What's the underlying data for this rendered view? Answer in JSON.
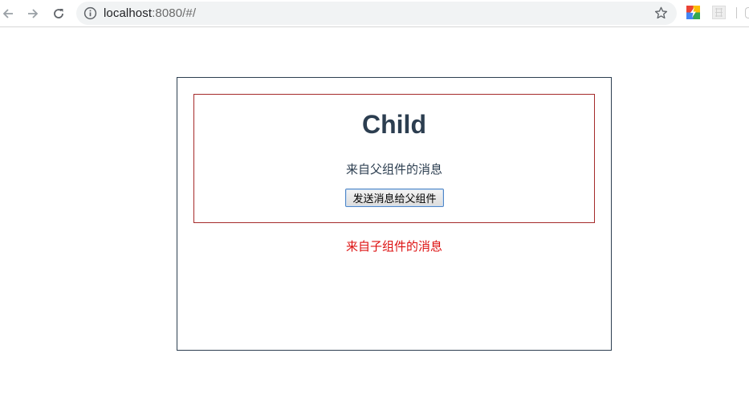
{
  "browser": {
    "url_host": "localhost",
    "url_rest": ":8080/#/",
    "icons": {
      "back": "back-arrow-icon",
      "forward": "forward-arrow-icon",
      "reload": "reload-icon",
      "info": "info-icon",
      "bookmark": "star-icon"
    }
  },
  "parent": {
    "border_color": "#2c3e50",
    "message": "来自子组件的消息",
    "message_color": "#dd1111"
  },
  "child": {
    "border_color": "#a52a2a",
    "title": "Child",
    "message": "来自父组件的消息",
    "button_label": "发送消息给父组件"
  }
}
